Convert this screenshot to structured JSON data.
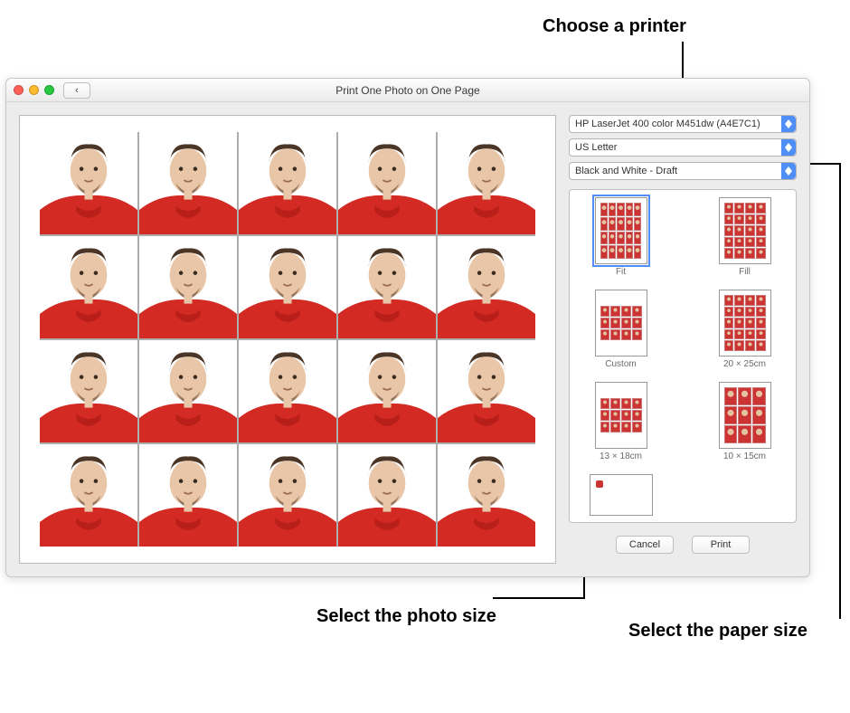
{
  "annotations": {
    "printer": "Choose a printer",
    "photo_size": "Select the photo size",
    "paper_size": "Select the paper size"
  },
  "window": {
    "title": "Print One Photo on One Page",
    "back_glyph": "‹"
  },
  "selects": {
    "printer": "HP LaserJet 400 color M451dw (A4E7C1)",
    "paper": "US Letter",
    "quality": "Black and White - Draft"
  },
  "layouts": [
    {
      "key": "fit",
      "label": "Fit",
      "grid": "g54",
      "selected": true
    },
    {
      "key": "fill",
      "label": "Fill",
      "grid": "g45",
      "selected": false
    },
    {
      "key": "custom",
      "label": "Custom",
      "grid": "g43",
      "selected": false
    },
    {
      "key": "20x25",
      "label": "20 × 25cm",
      "grid": "g45",
      "selected": false
    },
    {
      "key": "13x18",
      "label": "13 × 18cm",
      "grid": "g43",
      "selected": false
    },
    {
      "key": "10x15",
      "label": "10 × 15cm",
      "grid": "g33",
      "selected": false
    },
    {
      "key": "single",
      "label": "",
      "grid": "single",
      "selected": false
    }
  ],
  "buttons": {
    "cancel": "Cancel",
    "print": "Print"
  },
  "preview": {
    "rows": 4,
    "cols": 5
  }
}
